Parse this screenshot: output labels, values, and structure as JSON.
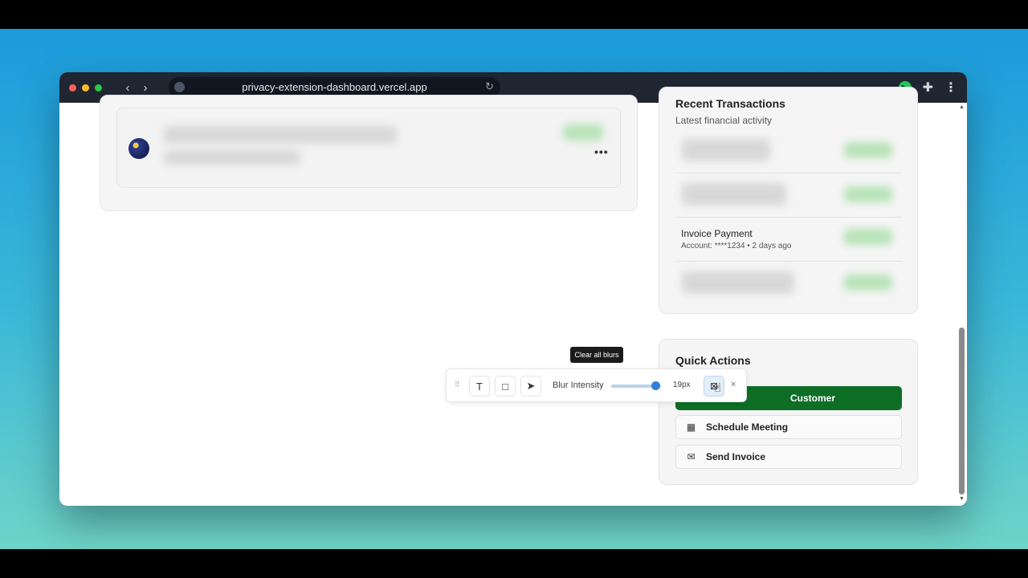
{
  "browser": {
    "url": "privacy-extension-dashboard.vercel.app",
    "nav_back": "‹",
    "nav_forward": "›",
    "reload_icon": "↻",
    "extension_icon": "▶",
    "puzzle_icon": "✚",
    "menu_icon": "⋮"
  },
  "left_card": {
    "more_label": "•••"
  },
  "recent_transactions": {
    "title": "Recent Transactions",
    "subtitle": "Latest financial activity",
    "visible_item": {
      "title": "Invoice Payment",
      "meta": "Account: ****1234 • 2 days ago"
    }
  },
  "quick_actions": {
    "title": "Quick Actions",
    "buttons": [
      {
        "label": "Customer",
        "icon": ""
      },
      {
        "label": "Schedule Meeting",
        "icon": "▦"
      },
      {
        "label": "Send Invoice",
        "icon": "✉"
      }
    ]
  },
  "toolbar": {
    "grip": "⠿",
    "text_tool": "T",
    "rect_tool": "□",
    "select_tool": "➤",
    "blur_label": "Blur Intensity",
    "blur_value": "19px",
    "blur_level": 0.9,
    "clear_icon": "⊠",
    "close_icon": "×",
    "tooltip": "Clear all blurs"
  },
  "cursor_icon": "☝",
  "colors": {
    "primary_green": "#0e6e26",
    "slider_blue": "#2f80d6",
    "titlebar": "#1f2632"
  }
}
